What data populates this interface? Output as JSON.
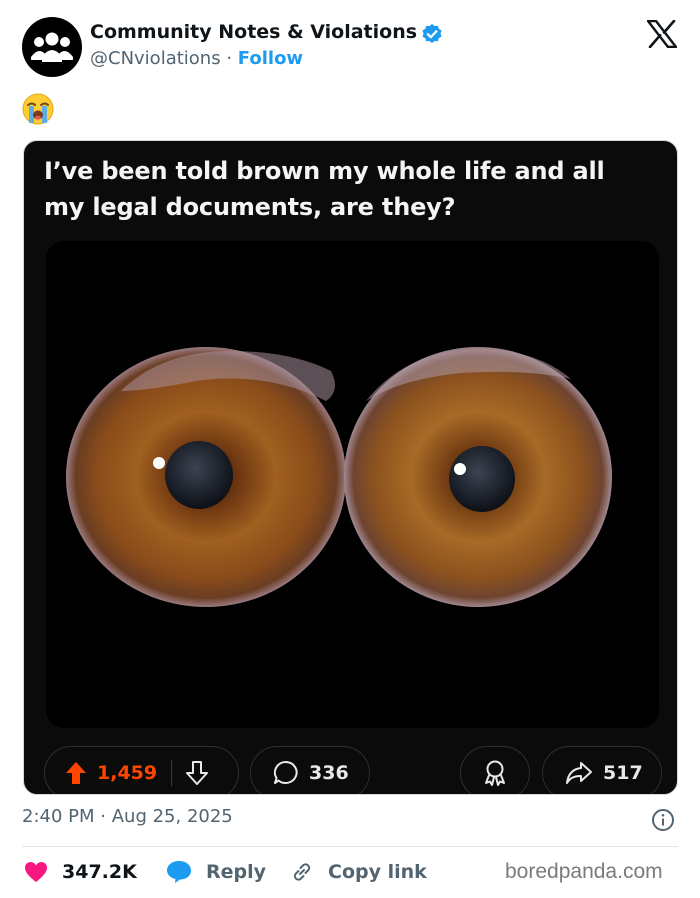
{
  "header": {
    "account_name": "Community Notes & Violations",
    "handle": "@CNviolations",
    "separator": "·",
    "follow_label": "Follow"
  },
  "tweet": {
    "emoji_icon": "loudly-crying-face-emoji"
  },
  "card": {
    "post_text": "I’ve been told brown my whole life and all my legal documents, are they?",
    "upvotes": "1,459",
    "comments": "336",
    "shares": "517",
    "upvote_color": "#ff4500"
  },
  "footer": {
    "time": "2:40 PM",
    "separator": "·",
    "date": "Aug 25, 2025",
    "likes": "347.2K",
    "reply_label": "Reply",
    "copy_link_label": "Copy link",
    "heart_color": "#f91880",
    "reply_color": "#1d9bf0"
  },
  "watermark": "boredpanda.com"
}
